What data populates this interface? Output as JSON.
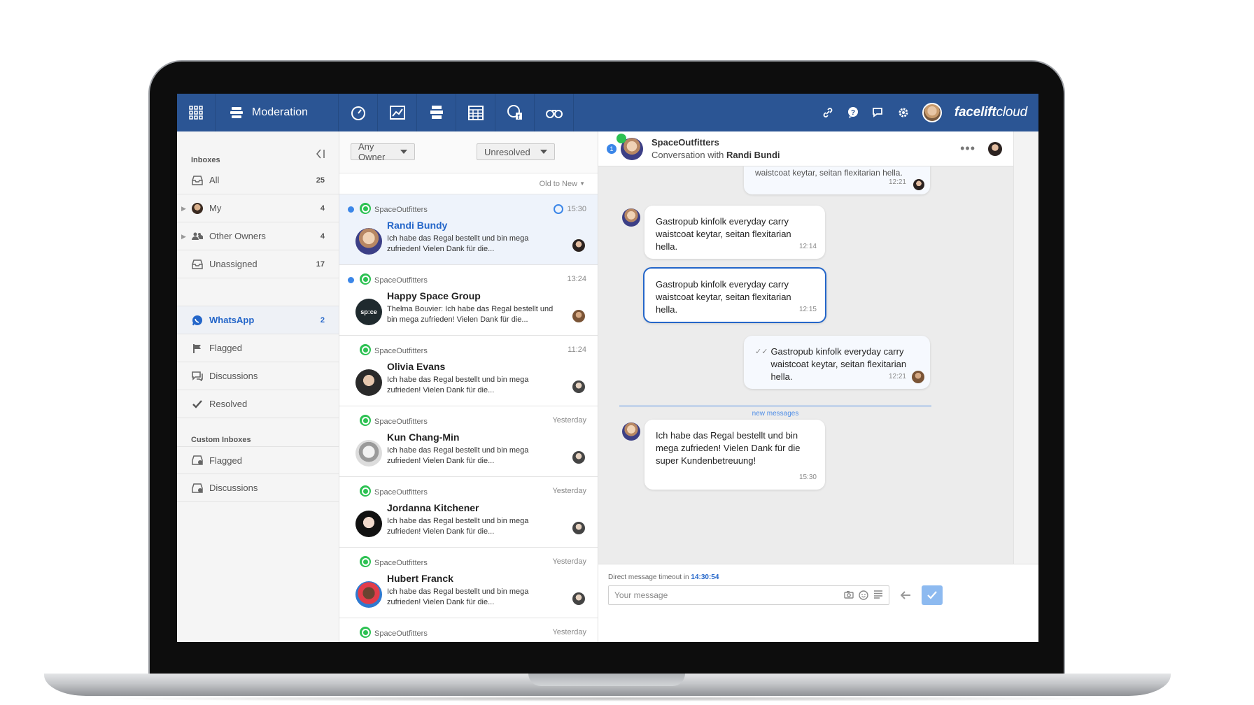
{
  "topbar": {
    "module": "Moderation",
    "brand_bold": "facelift",
    "brand_light": "cloud",
    "nav_icons": [
      "dashboard-icon",
      "analytics-icon",
      "moderation-icon",
      "calendar-icon",
      "facebook-touch-icon",
      "binoculars-icon"
    ],
    "right_icons": [
      "link-icon",
      "help-icon",
      "chat-icon",
      "gear-icon"
    ]
  },
  "sidebar": {
    "inboxes_title": "Inboxes",
    "items": [
      {
        "label": "All",
        "count": "25",
        "icon": "inbox-icon"
      },
      {
        "label": "My",
        "count": "4",
        "icon": "avatar-icon"
      },
      {
        "label": "Other Owners",
        "count": "4",
        "icon": "users-icon"
      },
      {
        "label": "Unassigned",
        "count": "17",
        "icon": "inbox-icon"
      }
    ],
    "channels": [
      {
        "label": "WhatsApp",
        "count": "2",
        "icon": "whatsapp-icon"
      },
      {
        "label": "Flagged",
        "count": "",
        "icon": "flag-icon"
      },
      {
        "label": "Discussions",
        "count": "",
        "icon": "discussions-icon"
      },
      {
        "label": "Resolved",
        "count": "",
        "icon": "check-icon"
      }
    ],
    "custom_title": "Custom Inboxes",
    "custom": [
      {
        "label": "Flagged",
        "icon": "custom-inbox-icon"
      },
      {
        "label": "Discussions",
        "icon": "custom-inbox-icon"
      }
    ]
  },
  "list": {
    "owner_filter": "Any Owner",
    "status_filter": "Unresolved",
    "sort": "Old to New",
    "conversations": [
      {
        "source": "SpaceOutfitters",
        "time": "15:30",
        "name": "Randi Bundy",
        "preview": "Ich habe das Regal bestellt und bin mega zufrieden! Vielen Dank für die...",
        "unread": true,
        "selected": true
      },
      {
        "source": "SpaceOutfitters",
        "time": "13:24",
        "name": "Happy Space Group",
        "preview_author": "Thelma Bouvier:",
        "preview": " Ich habe das Regal bestellt und bin mega zufrieden! Vielen Dank für die...",
        "unread": true,
        "selected": false,
        "logo": "sp:ce"
      },
      {
        "source": "SpaceOutfitters",
        "time": "11:24",
        "name": "Olivia Evans",
        "preview": "Ich habe das Regal bestellt und bin mega zufrieden! Vielen Dank für die...",
        "unread": false
      },
      {
        "source": "SpaceOutfitters",
        "time": "Yesterday",
        "name": "Kun Chang-Min",
        "preview": "Ich habe das Regal bestellt und bin mega zufrieden! Vielen Dank für die...",
        "unread": false
      },
      {
        "source": "SpaceOutfitters",
        "time": "Yesterday",
        "name": "Jordanna Kitchener",
        "preview": "Ich habe das Regal bestellt und bin mega zufrieden! Vielen Dank für die...",
        "unread": false
      },
      {
        "source": "SpaceOutfitters",
        "time": "Yesterday",
        "name": "Hubert Franck",
        "preview": "Ich habe das Regal bestellt und bin mega zufrieden! Vielen Dank für die...",
        "unread": false
      },
      {
        "source": "SpaceOutfitters",
        "time": "Yesterday",
        "name": "",
        "preview": "",
        "unread": false
      }
    ]
  },
  "chat": {
    "badge": "1",
    "title": "SpaceOutfitters",
    "subtitle_prefix": "Conversation with ",
    "subtitle_name": "Randi Bundi",
    "messages": [
      {
        "text": "waistcoat keytar, seitan flexitarian hella.",
        "time": "12:21",
        "dir": "out"
      },
      {
        "text": "Gastropub kinfolk everyday carry waistcoat keytar, seitan flexitarian hella.",
        "time": "12:14",
        "dir": "in"
      },
      {
        "text": "Gastropub kinfolk everyday carry waistcoat keytar, seitan flexitarian hella.",
        "time": "12:15",
        "dir": "in",
        "highlighted": true
      },
      {
        "text": "Gastropub kinfolk everyday carry waistcoat keytar, seitan flexitarian hella.",
        "time": "12:21",
        "dir": "out"
      },
      {
        "text": "Ich habe das Regal bestellt und bin mega zufrieden! Vielen Dank für die super Kundenbetreuung!",
        "time": "15:30",
        "dir": "in"
      }
    ],
    "new_messages_label": "new messages",
    "timeout_label": "Direct message timeout in",
    "timeout_value": "14:30:54",
    "composer_placeholder": "Your message"
  },
  "colors": {
    "topbar": "#2b5594",
    "accent": "#2466c9",
    "whatsapp": "#2cc152"
  }
}
